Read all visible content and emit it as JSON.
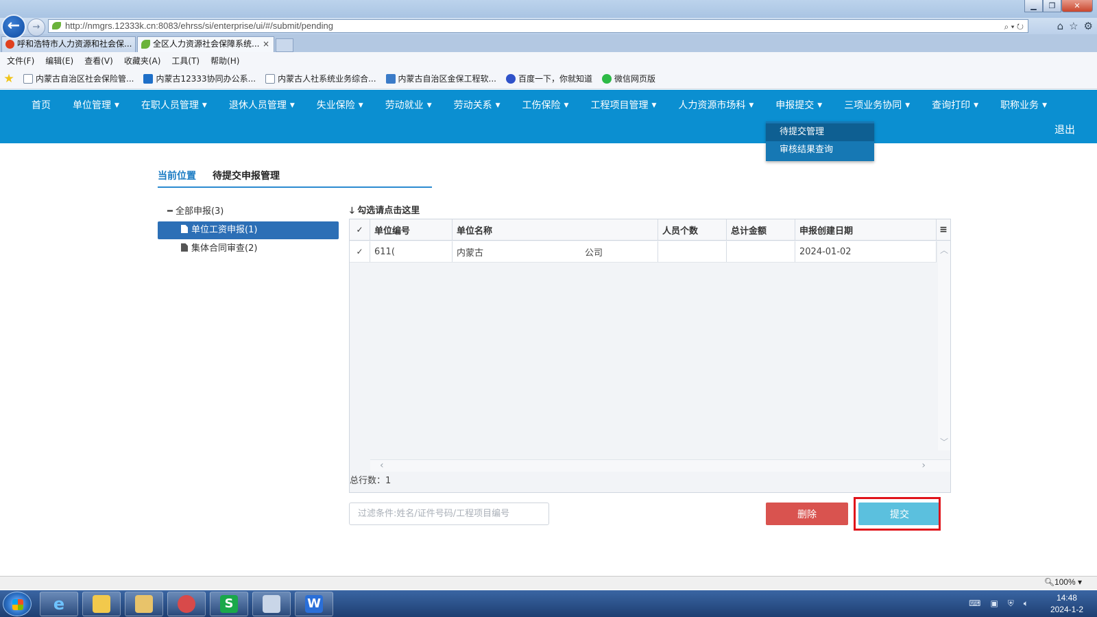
{
  "browser": {
    "url": "http://nmgrs.12333k.cn:8083/ehrss/si/enterprise/ui/#/submit/pending",
    "tabs": [
      {
        "title": "呼和浩特市人力资源和社会保..."
      },
      {
        "title": "全区人力资源社会保障系统...",
        "close": "×"
      }
    ],
    "menu": [
      "文件(F)",
      "编辑(E)",
      "查看(V)",
      "收藏夹(A)",
      "工具(T)",
      "帮助(H)"
    ],
    "favorites": [
      "内蒙古自治区社会保险管...",
      "内蒙古12333协同办公系...",
      "内蒙古人社系统业务综合...",
      "内蒙古自治区金保工程软...",
      "百度一下，你就知道",
      "微信网页版"
    ],
    "zoom": "100%"
  },
  "nav": {
    "items": [
      {
        "label": "首页",
        "caret": ""
      },
      {
        "label": "单位管理",
        "caret": "▼"
      },
      {
        "label": "在职人员管理",
        "caret": "▼"
      },
      {
        "label": "退休人员管理",
        "caret": "▼"
      },
      {
        "label": "失业保险",
        "caret": "▼"
      },
      {
        "label": "劳动就业",
        "caret": "▼"
      },
      {
        "label": "劳动关系",
        "caret": "▼"
      },
      {
        "label": "工伤保险",
        "caret": "▼"
      },
      {
        "label": "工程项目管理",
        "caret": "▼"
      },
      {
        "label": "人力资源市场科",
        "caret": "▼"
      },
      {
        "label": "申报提交",
        "caret": "▼"
      },
      {
        "label": "三项业务协同",
        "caret": "▼"
      },
      {
        "label": "查询打印",
        "caret": "▼"
      },
      {
        "label": "职称业务",
        "caret": "▼"
      }
    ],
    "logout": "退出",
    "dropdown": [
      "待提交管理",
      "审核结果查询"
    ]
  },
  "breadcrumb": {
    "label": "当前位置",
    "current": "待提交申报管理"
  },
  "tree": {
    "root": "全部申报(3)",
    "nodes": [
      "单位工资申报(1)",
      "集体合同审查(2)"
    ]
  },
  "hint": "勾选请点击这里",
  "grid": {
    "headers": [
      "单位编号",
      "单位名称",
      "人员个数",
      "总计金额",
      "申报创建日期"
    ],
    "rows": [
      {
        "code": "611(",
        "name_a": "内蒙古",
        "name_b": "公司",
        "count": "",
        "amount": "",
        "date": "2024-01-02"
      }
    ],
    "total_label": "总行数：",
    "total": "1"
  },
  "filter": {
    "placeholder": "过滤条件:姓名/证件号码/工程项目编号"
  },
  "buttons": {
    "delete": "删除",
    "submit": "提交"
  },
  "taskbar": {
    "time": "14:48",
    "date": "2024-1-2"
  }
}
